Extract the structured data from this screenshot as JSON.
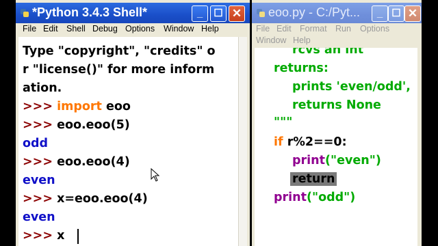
{
  "shell": {
    "title": "*Python 3.4.3 Shell*",
    "menu": [
      "File",
      "Edit",
      "Shell",
      "Debug",
      "Options",
      "Window",
      "Help"
    ],
    "intro": [
      "Type \"copyright\", \"credits\" o",
      "r \"license()\" for more inform",
      "ation."
    ],
    "prompt": ">>>",
    "lines": [
      {
        "kw": "import",
        "rest": "eoo"
      },
      {
        "code": "eoo.eoo(5)"
      },
      {
        "out": "odd"
      },
      {
        "code": "eoo.eoo(4)"
      },
      {
        "out": "even"
      },
      {
        "code": "x=eoo.eoo(4)"
      },
      {
        "out": "even"
      },
      {
        "code": "x"
      }
    ]
  },
  "editor": {
    "title": "eoo.py - C:/Pyt...",
    "menu": [
      "File",
      "Edit",
      "Format",
      "Run",
      "Options",
      "Window",
      "Help"
    ],
    "doc": [
      "rcvs an int",
      "returns:",
      "prints 'even/odd',",
      "returns None",
      "\"\"\""
    ],
    "code": {
      "if_kw": "if",
      "cond": "r%2==0:",
      "print1": "print",
      "arg1": "(\"even\")",
      "return_kw": "return",
      "print2": "print",
      "arg2": "(\"odd\")"
    }
  },
  "colors": {
    "keyword": "#ff7700",
    "builtin": "#900090",
    "string": "#00aa00",
    "output": "#1010c8",
    "prompt": "#8b0000",
    "titlebar_active": "#2d6be0"
  },
  "icons": [
    "python-icon",
    "minimize-icon",
    "maximize-icon",
    "close-icon",
    "mouse-pointer-icon"
  ]
}
